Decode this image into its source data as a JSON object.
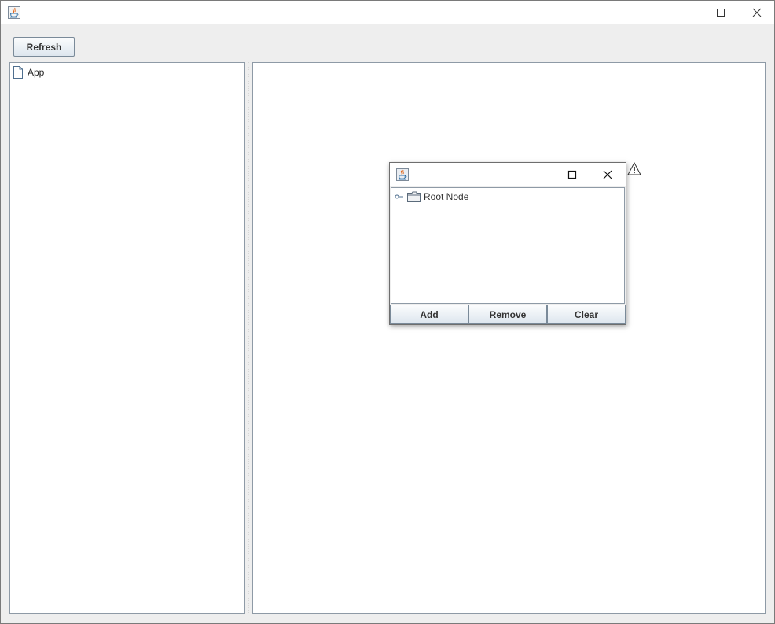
{
  "main_window": {
    "title": "",
    "icon": "java-icon",
    "controls": {
      "minimize": "minimize-icon",
      "maximize": "maximize-icon",
      "close": "close-icon"
    }
  },
  "toolbar": {
    "refresh_label": "Refresh"
  },
  "left_tree": {
    "items": [
      {
        "label": "App",
        "icon": "file-icon"
      }
    ]
  },
  "inner_frame": {
    "title": "",
    "icon": "java-icon",
    "tree": {
      "root_label": "Root Node",
      "root_icon": "folder-icon",
      "handle_icon": "tree-handle-icon"
    },
    "buttons": {
      "add_label": "Add",
      "remove_label": "Remove",
      "clear_label": "Clear"
    }
  },
  "overlay": {
    "warning_icon": "warning-icon"
  },
  "colors": {
    "window_bg": "#eeeeee",
    "panel_bg": "#ffffff",
    "panel_border": "#8e9aa6",
    "button_top": "#fbfcfd",
    "button_bottom": "#dde6ee"
  }
}
